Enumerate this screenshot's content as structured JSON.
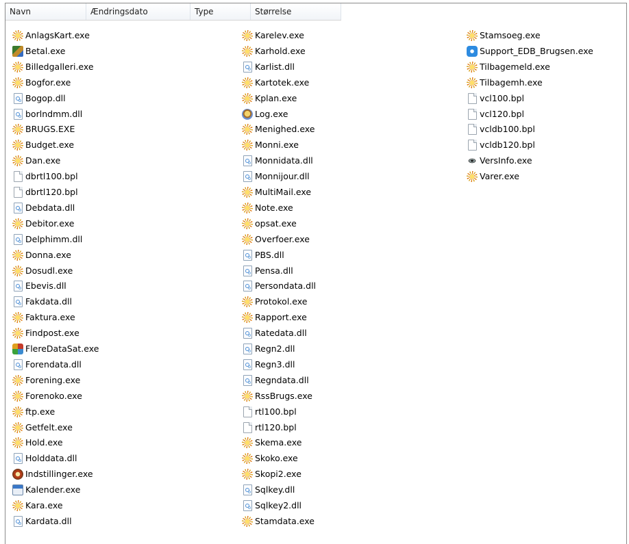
{
  "header": {
    "columns": [
      "Navn",
      "Ændringsdato",
      "Type",
      "Størrelse"
    ]
  },
  "columns": [
    [
      {
        "name": "AnlagsKart.exe",
        "icon": "exe-icon"
      },
      {
        "name": "Betal.exe",
        "icon": "app-icon-betal"
      },
      {
        "name": "Billedgalleri.exe",
        "icon": "exe-icon"
      },
      {
        "name": "Bogfor.exe",
        "icon": "exe-icon"
      },
      {
        "name": "Bogop.dll",
        "icon": "dll-icon"
      },
      {
        "name": "borlndmm.dll",
        "icon": "dll-icon"
      },
      {
        "name": "BRUGS.EXE",
        "icon": "exe-icon"
      },
      {
        "name": "Budget.exe",
        "icon": "exe-icon"
      },
      {
        "name": "Dan.exe",
        "icon": "exe-icon"
      },
      {
        "name": "dbrtl100.bpl",
        "icon": "bpl-icon"
      },
      {
        "name": "dbrtl120.bpl",
        "icon": "bpl-icon"
      },
      {
        "name": "Debdata.dll",
        "icon": "dll-icon"
      },
      {
        "name": "Debitor.exe",
        "icon": "exe-icon"
      },
      {
        "name": "Delphimm.dll",
        "icon": "dll-icon"
      },
      {
        "name": "Donna.exe",
        "icon": "exe-icon"
      },
      {
        "name": "Dosudl.exe",
        "icon": "exe-icon"
      },
      {
        "name": "Ebevis.dll",
        "icon": "dll-icon"
      },
      {
        "name": "Fakdata.dll",
        "icon": "dll-icon"
      },
      {
        "name": "Faktura.exe",
        "icon": "exe-icon"
      },
      {
        "name": "Findpost.exe",
        "icon": "exe-icon"
      },
      {
        "name": "FlereDataSat.exe",
        "icon": "app-icon-multi"
      },
      {
        "name": "Forendata.dll",
        "icon": "dll-icon"
      },
      {
        "name": "Forening.exe",
        "icon": "exe-icon"
      },
      {
        "name": "Forenoko.exe",
        "icon": "exe-icon"
      },
      {
        "name": "ftp.exe",
        "icon": "exe-icon"
      },
      {
        "name": "Getfelt.exe",
        "icon": "exe-icon"
      },
      {
        "name": "Hold.exe",
        "icon": "exe-icon"
      },
      {
        "name": "Holddata.dll",
        "icon": "dll-icon"
      },
      {
        "name": "Indstillinger.exe",
        "icon": "app-icon-indstillinger"
      },
      {
        "name": "Kalender.exe",
        "icon": "calendar-icon"
      },
      {
        "name": "Kara.exe",
        "icon": "exe-icon"
      },
      {
        "name": "Kardata.dll",
        "icon": "dll-icon"
      }
    ],
    [
      {
        "name": "Karelev.exe",
        "icon": "exe-icon"
      },
      {
        "name": "Karhold.exe",
        "icon": "exe-icon"
      },
      {
        "name": "Karlist.dll",
        "icon": "dll-icon"
      },
      {
        "name": "Kartotek.exe",
        "icon": "exe-icon"
      },
      {
        "name": "Kplan.exe",
        "icon": "exe-icon"
      },
      {
        "name": "Log.exe",
        "icon": "app-icon-log"
      },
      {
        "name": "Menighed.exe",
        "icon": "exe-icon"
      },
      {
        "name": "Monni.exe",
        "icon": "exe-icon"
      },
      {
        "name": "Monnidata.dll",
        "icon": "dll-icon"
      },
      {
        "name": "Monnijour.dll",
        "icon": "dll-icon"
      },
      {
        "name": "MultiMail.exe",
        "icon": "exe-icon"
      },
      {
        "name": "Note.exe",
        "icon": "exe-icon"
      },
      {
        "name": "opsat.exe",
        "icon": "exe-icon"
      },
      {
        "name": "Overfoer.exe",
        "icon": "exe-icon"
      },
      {
        "name": "PBS.dll",
        "icon": "dll-icon"
      },
      {
        "name": "Pensa.dll",
        "icon": "dll-icon"
      },
      {
        "name": "Persondata.dll",
        "icon": "dll-icon"
      },
      {
        "name": "Protokol.exe",
        "icon": "exe-icon"
      },
      {
        "name": "Rapport.exe",
        "icon": "exe-icon"
      },
      {
        "name": "Ratedata.dll",
        "icon": "dll-icon"
      },
      {
        "name": "Regn2.dll",
        "icon": "dll-icon"
      },
      {
        "name": "Regn3.dll",
        "icon": "dll-icon"
      },
      {
        "name": "Regndata.dll",
        "icon": "dll-icon"
      },
      {
        "name": "RssBrugs.exe",
        "icon": "exe-icon"
      },
      {
        "name": "rtl100.bpl",
        "icon": "bpl-icon"
      },
      {
        "name": "rtl120.bpl",
        "icon": "bpl-icon"
      },
      {
        "name": "Skema.exe",
        "icon": "exe-icon"
      },
      {
        "name": "Skoko.exe",
        "icon": "exe-icon"
      },
      {
        "name": "Skopi2.exe",
        "icon": "exe-icon"
      },
      {
        "name": "Sqlkey.dll",
        "icon": "dll-icon"
      },
      {
        "name": "Sqlkey2.dll",
        "icon": "dll-icon"
      },
      {
        "name": "Stamdata.exe",
        "icon": "exe-icon"
      }
    ],
    [
      {
        "name": "Stamsoeg.exe",
        "icon": "exe-icon"
      },
      {
        "name": "Support_EDB_Brugsen.exe",
        "icon": "support-icon"
      },
      {
        "name": "Tilbagemeld.exe",
        "icon": "exe-icon"
      },
      {
        "name": "Tilbagemh.exe",
        "icon": "exe-icon"
      },
      {
        "name": "vcl100.bpl",
        "icon": "bpl-icon"
      },
      {
        "name": "vcl120.bpl",
        "icon": "bpl-icon"
      },
      {
        "name": "vcldb100.bpl",
        "icon": "bpl-icon"
      },
      {
        "name": "vcldb120.bpl",
        "icon": "bpl-icon"
      },
      {
        "name": "VersInfo.exe",
        "icon": "eye-icon"
      },
      {
        "name": "Varer.exe",
        "icon": "exe-icon"
      }
    ]
  ]
}
